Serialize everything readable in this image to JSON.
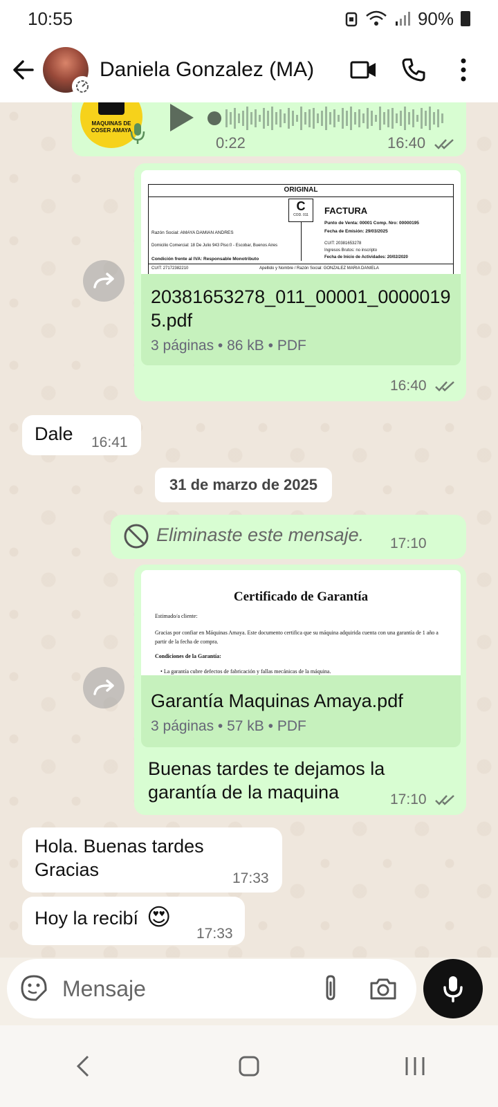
{
  "status": {
    "time": "10:55",
    "battery": "90%"
  },
  "header": {
    "contact_name": "Daniela Gonzalez (MA)"
  },
  "voice": {
    "duration": "0:22",
    "time": "16:40",
    "logo_text": "MAQUINAS DE COSER AMAYA"
  },
  "invoice": {
    "original": "ORIGINAL",
    "letter": "C",
    "cod": "COD. 011",
    "title": "FACTURA",
    "razon": "Razón Social:  AMAYA DAMIAN ANDRES",
    "domicilio": "Domicilio Comercial:  18 De Julio 943 Piso:0 - Escobar, Buenos Aires",
    "condicion": "Condición frente al IVA:   Responsable Monotributo",
    "punto": "Punto de Venta:  00001     Comp. Nro:  00000195",
    "fecha": "Fecha de Emisión:  29/03/2025",
    "cuit": "CUIT:  20381653278",
    "ingresos": "Ingresos Brutos:   no inscripto",
    "inicio": "Fecha de Inicio de Actividades:     20/02/2020",
    "cuit2": "CUIT: 27172382210",
    "apellido": "Apellido y Nombre / Razón Social: GONZALEZ MARIA DANIELA",
    "file_name": "20381653278_011_00001_00000195.pdf",
    "file_meta": "3 páginas • 86 kB • PDF",
    "time": "16:40"
  },
  "msg_dale": {
    "text": "Dale",
    "time": "16:41"
  },
  "date_chip": "31 de marzo de 2025",
  "deleted": {
    "text": "Eliminaste este mensaje.",
    "time": "17:10"
  },
  "warranty": {
    "title": "Certificado de Garantía",
    "greeting": "Estimado/a cliente:",
    "body": "Gracias por confiar en Máquinas Amaya. Este documento certifica que su máquina adquirida cuenta con una garantía de 1 año a partir de la fecha de compra.",
    "conditions": "Condiciones de la Garantía:",
    "bullet": "La garantía cubre defectos de fabricación y fallas mecánicas de la máquina.",
    "file_name": "Garantía Maquinas Amaya.pdf",
    "file_meta": "3 páginas • 57 kB • PDF",
    "caption": "Buenas tardes te dejamos la garantía de la maquina",
    "time": "17:10"
  },
  "msg_hola": {
    "text": "Hola. Buenas tardes Gracias",
    "time": "17:33"
  },
  "msg_recibi": {
    "text": "Hoy la recibí",
    "emoji": "😍",
    "time": "17:33"
  },
  "composer": {
    "placeholder": "Mensaje"
  }
}
